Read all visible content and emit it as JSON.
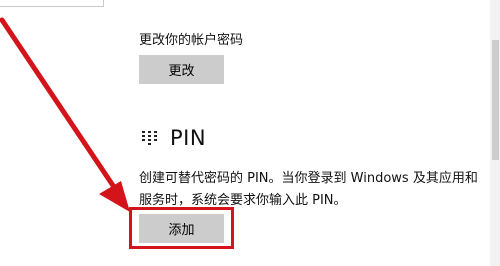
{
  "password_section": {
    "label": "更改你的帐户密码",
    "button_label": "更改"
  },
  "pin_section": {
    "icon": "keypad-icon",
    "title": "PIN",
    "description": "创建可替代密码的 PIN。当你登录到 Windows 及其应用和服务时，系统会要求你输入此 PIN。",
    "add_button_label": "添加"
  },
  "annotation": {
    "highlight_color": "#d4141b"
  }
}
